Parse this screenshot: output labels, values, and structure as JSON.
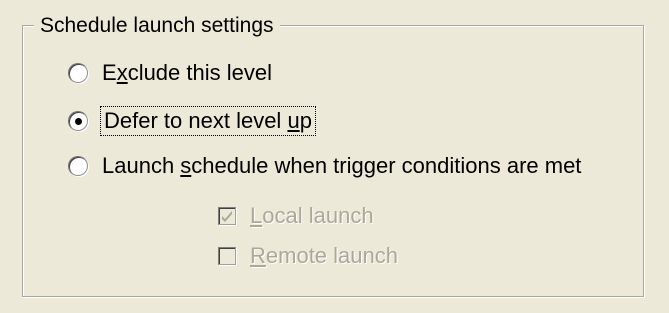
{
  "group": {
    "title": "Schedule launch settings"
  },
  "options": {
    "exclude": {
      "pre": "E",
      "accel": "x",
      "post": "clude this level",
      "selected": false
    },
    "defer": {
      "pre": "Defer to next level ",
      "accel": "u",
      "post": "p",
      "selected": true
    },
    "launch": {
      "pre": "Launch ",
      "accel": "s",
      "post": "chedule when trigger conditions are met",
      "selected": false
    }
  },
  "checks": {
    "local": {
      "pre": "",
      "accel": "L",
      "post": "ocal launch",
      "checked": true,
      "enabled": false
    },
    "remote": {
      "pre": "",
      "accel": "R",
      "post": "emote launch",
      "checked": false,
      "enabled": false
    }
  },
  "icons": {
    "radio_selected": "radio-dot",
    "checkbox_checked": "check-mark"
  }
}
